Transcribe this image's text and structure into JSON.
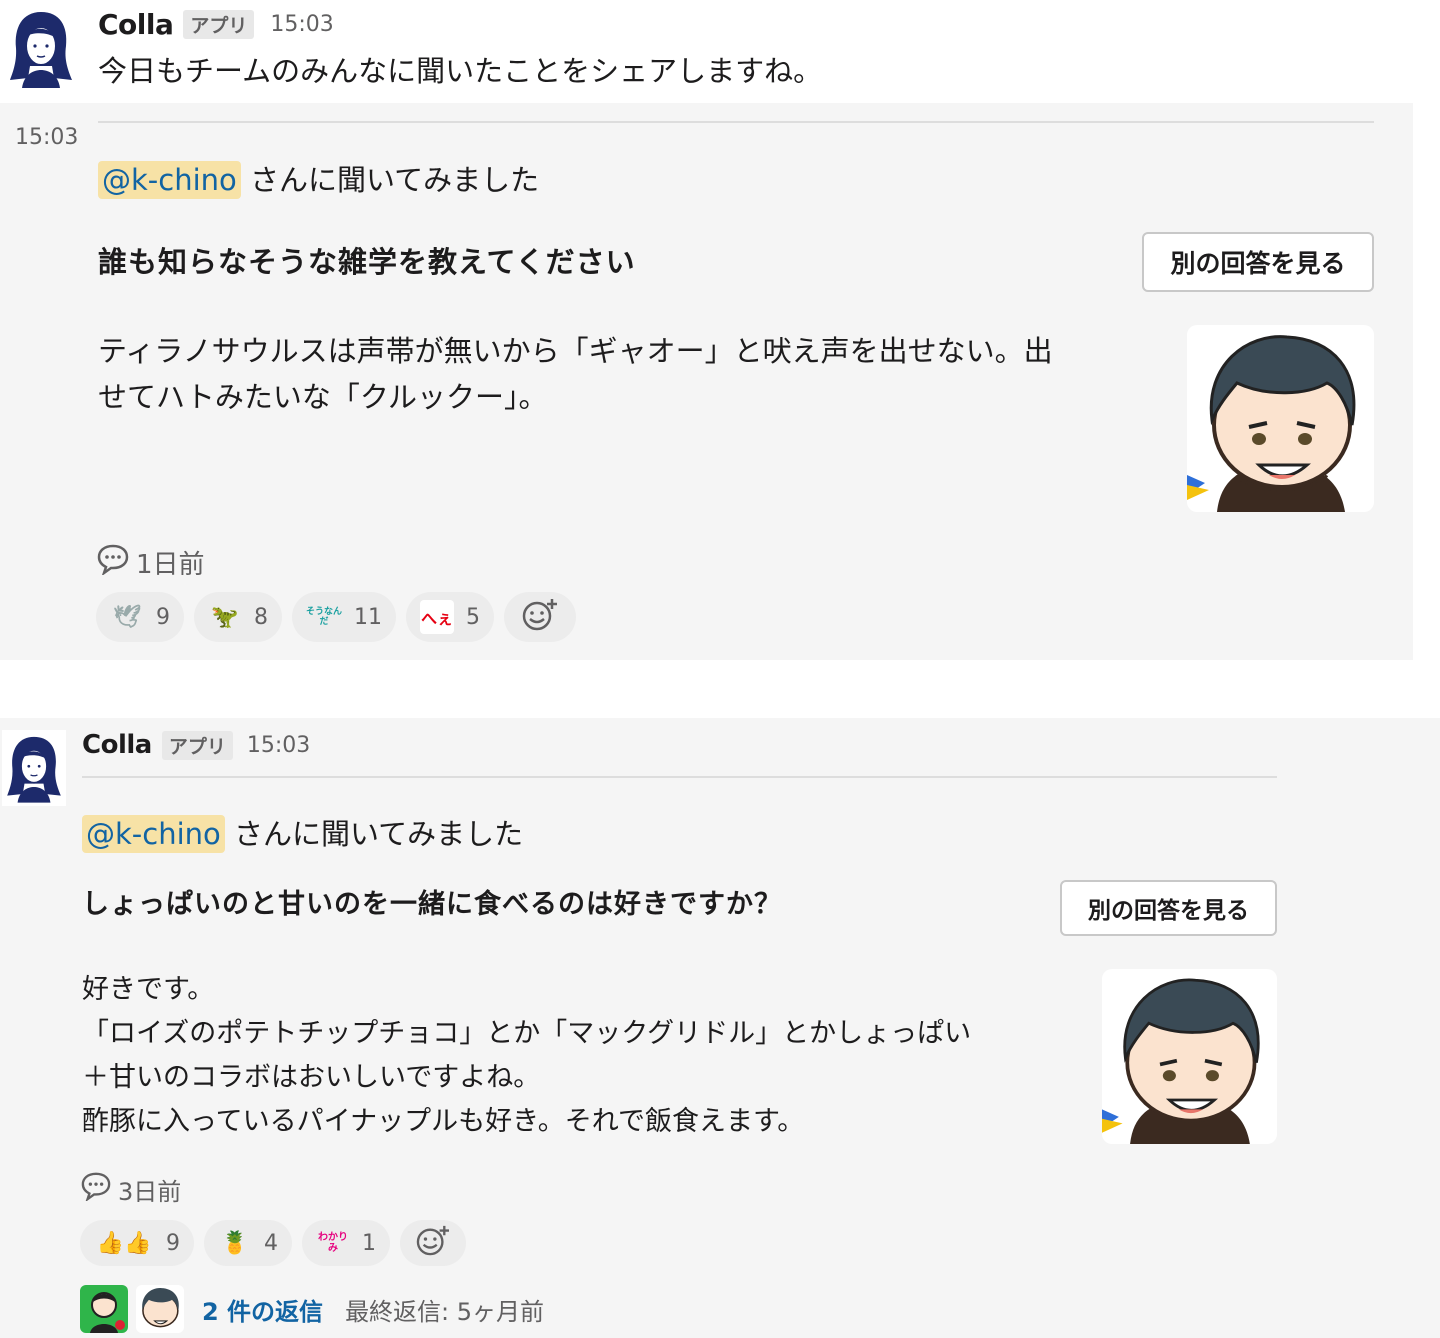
{
  "msg1": {
    "sender": "Colla",
    "badge": "アプリ",
    "time": "15:03",
    "text": "今日もチームのみんなに聞いたことをシェアしますね。"
  },
  "card1": {
    "time": "15:03",
    "mention": "@k-chino",
    "intro": "さんに聞いてみました",
    "question": "誰も知らなそうな雑学を教えてください",
    "button": "別の回答を見る",
    "answer": [
      "ティラノサウルスは声帯が無いから「ギャオー」と吠え声を出せない。出",
      "せてハトみたいな「クルックー」。"
    ],
    "comment_time": "1日前",
    "reactions": [
      {
        "icon": "dove-emoji-icon",
        "glyph": "🕊",
        "count": "9"
      },
      {
        "icon": "t-rex-emoji-icon",
        "glyph": "🦖",
        "count": "8"
      },
      {
        "icon": "sounanda-emoji-icon",
        "glyph": "そうなんだ",
        "count": "11"
      },
      {
        "icon": "hee-emoji-icon",
        "glyph": "へぇ",
        "count": "5"
      }
    ]
  },
  "msg2": {
    "sender": "Colla",
    "badge": "アプリ",
    "time": "15:03",
    "mention": "@k-chino",
    "intro": "さんに聞いてみました",
    "question": "しょっぱいのと甘いのを一緒に食べるのは好きですか？",
    "button": "別の回答を見る",
    "answer": [
      "好きです。",
      "「ロイズのポテトチップチョコ」とか「マックグリドル」とかしょっぱい",
      "＋甘いのコラボはおいしいですよね。",
      "酢豚に入っているパイナップルも好き。それで飯食えます。"
    ],
    "comment_time": "3日前",
    "reactions": [
      {
        "icon": "thumbs-up-emoji-icon",
        "glyph": "👍👍",
        "count": "9"
      },
      {
        "icon": "pineapple-emoji-icon",
        "glyph": "🍍",
        "count": "4"
      },
      {
        "icon": "wakarimi-emoji-icon",
        "glyph": "わかりみ",
        "count": "1"
      }
    ],
    "replies": "2 件の返信",
    "last_reply": "最終返信: 5ヶ月前"
  },
  "colors": {
    "mention_bg": "#f7e2a6",
    "link": "#1264a3",
    "card_bg": "#f5f5f5"
  }
}
